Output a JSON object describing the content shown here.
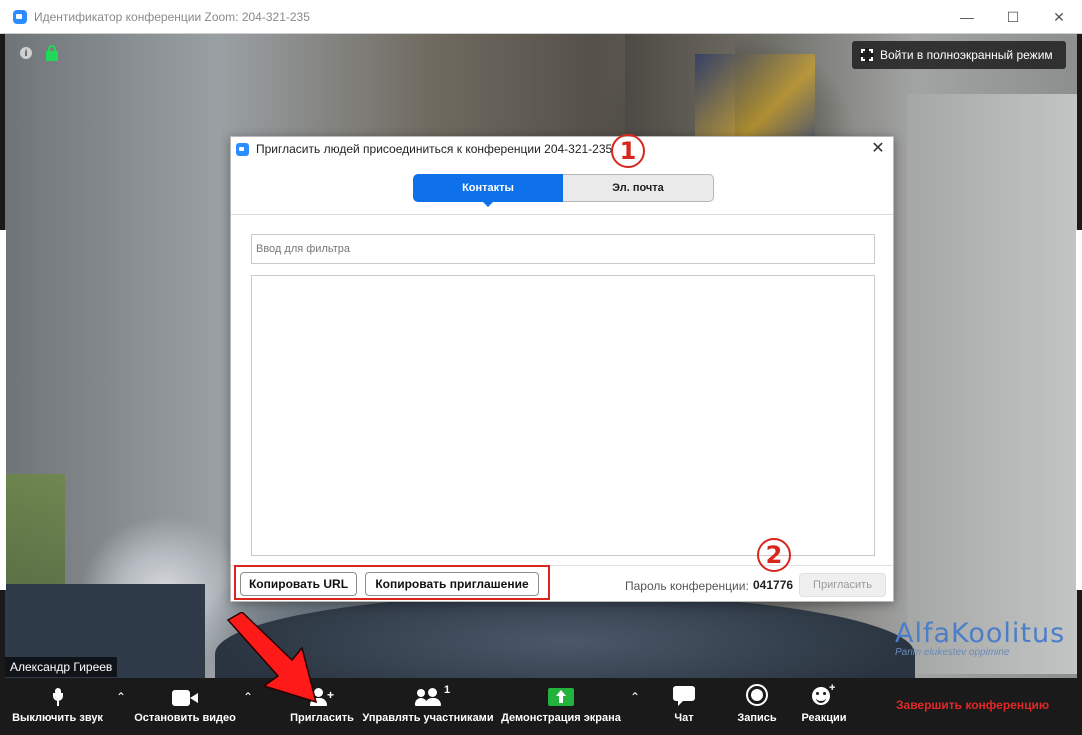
{
  "window": {
    "title": "Идентификатор конференции Zoom: 204-321-235",
    "minimize_icon": "minimize-icon",
    "maximize_icon": "maximize-icon",
    "close_icon": "close-icon"
  },
  "video": {
    "fullscreen_label": "Войти в полноэкранный режим",
    "participant_name": "Александр Гиреев",
    "watermark_brand": "AlfaKoolitus",
    "watermark_tagline": "Parim elukestev oppimine"
  },
  "dialog": {
    "title": "Пригласить людей присоединиться к конференции 204-321-235",
    "tabs": [
      {
        "label": "Контакты",
        "active": true
      },
      {
        "label": "Эл. почта",
        "active": false
      }
    ],
    "filter_placeholder": "Ввод для фильтра",
    "copy_url_label": "Копировать URL",
    "copy_invite_label": "Копировать приглашение",
    "password_label": "Пароль конференции:",
    "password_value": "041776",
    "invite_label": "Пригласить",
    "annotation_1": "1",
    "annotation_2": "2"
  },
  "toolbar": {
    "mute_label": "Выключить звук",
    "stop_video_label": "Остановить видео",
    "invite_label": "Пригласить",
    "participants_label": "Управлять участниками",
    "participants_count": "1",
    "share_label": "Демонстрация экрана",
    "chat_label": "Чат",
    "record_label": "Запись",
    "reactions_label": "Реакции",
    "end_label": "Завершить конференцию"
  },
  "colors": {
    "zoom_blue": "#2d8cff",
    "tab_active": "#0e71eb",
    "annotation_red": "#d8261d",
    "end_red": "#e02828",
    "share_green": "#23b23b",
    "lock_green": "#23d959"
  }
}
